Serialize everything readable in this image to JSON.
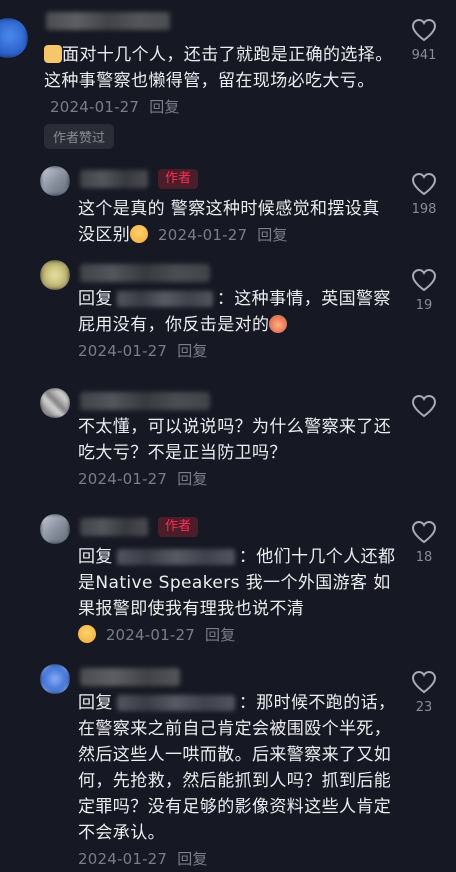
{
  "comments": [
    {
      "text": "面对十几个人，还击了就跑是正确的选择。这种事警察也懒得管，留在现场必吃大亏。",
      "date": "2024-01-27",
      "reply_label": "回复",
      "likes": "941",
      "liked_badge": "作者赞过",
      "leading_emoji": "thumbs-up"
    },
    {
      "author_tag": "作者",
      "text": "这个是真的 警察这种时候感觉和摆设真没区别",
      "date": "2024-01-27",
      "reply_label": "回复",
      "likes": "198",
      "trailing_emoji": "crying-face"
    },
    {
      "reply_prefix": "回复",
      "text": "：这种事情，英国警察屁用没有，你反击是对的",
      "date": "2024-01-27",
      "reply_label": "回复",
      "likes": "19",
      "trailing_emoji": "peach-face"
    },
    {
      "text": "不太懂，可以说说吗？为什么警察来了还吃大亏？不是正当防卫吗？",
      "date": "2024-01-27",
      "reply_label": "回复",
      "likes": ""
    },
    {
      "author_tag": "作者",
      "reply_prefix": "回复",
      "text": "：他们十几个人还都是Native Speakers 我一个外国游客 如果报警即使我有理我也说不清",
      "date": "2024-01-27",
      "reply_label": "回复",
      "likes": "18",
      "trailing_emoji": "crying-face"
    },
    {
      "reply_prefix": "回复",
      "text": "：那时候不跑的话，在警察来之前自己肯定会被围殴个半死，然后这些人一哄而散。后来警察来了又如何，先抢救，然后能抓到人吗？抓到后能定罪吗？没有足够的影像资料这些人肯定不会承认。",
      "date": "2024-01-27",
      "reply_label": "回复",
      "likes": "23"
    }
  ],
  "colors": {
    "background": "#161823",
    "author_tag_text": "#fe2c55",
    "meta_text": "#7c7d87"
  }
}
